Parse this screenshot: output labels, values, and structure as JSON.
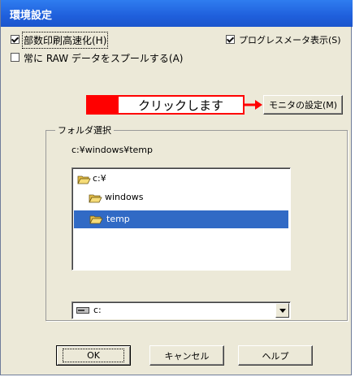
{
  "window": {
    "title": "環境設定"
  },
  "options": {
    "high_speed_print": {
      "label": "部数印刷高速化(H)",
      "checked": true
    },
    "progress_meter": {
      "label": "プログレスメータ表示(S)",
      "checked": true
    },
    "always_spool_raw": {
      "label": "常に RAW データをスプールする(A)",
      "checked": false
    }
  },
  "callout": {
    "text": "クリックします",
    "color": "#ff0000"
  },
  "monitor_button": {
    "label": "モニタの設定(M)"
  },
  "folder_group": {
    "title": "フォルダ選択",
    "current_path": "c:¥windows¥temp",
    "tree": [
      {
        "label": "c:¥",
        "selected": false
      },
      {
        "label": "windows",
        "selected": false
      },
      {
        "label": "temp",
        "selected": true
      }
    ],
    "drive_select": {
      "value": "c:"
    }
  },
  "buttons": {
    "ok": "OK",
    "cancel": "キャンセル",
    "help": "ヘルプ"
  },
  "colors": {
    "selection": "#316ac5",
    "title_bar": "#1f5fdc"
  }
}
